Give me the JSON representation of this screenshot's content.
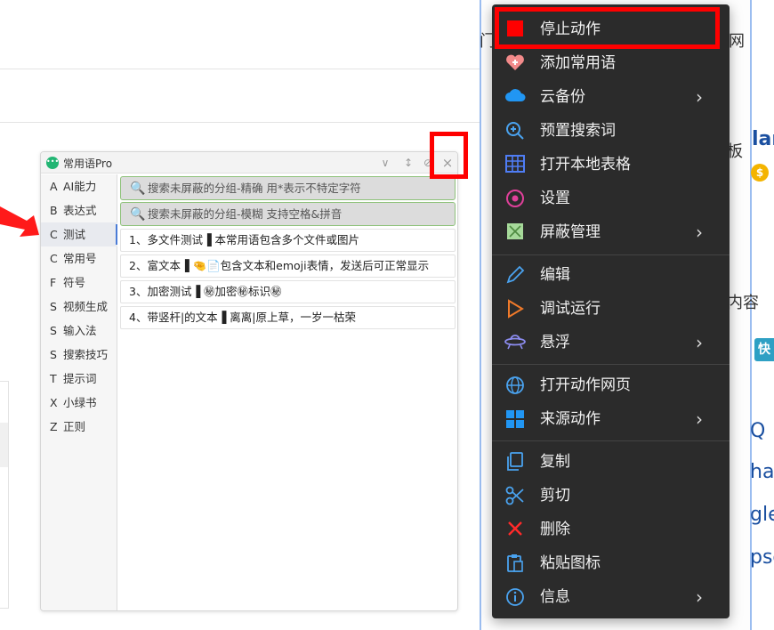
{
  "app": {
    "logo_glyph": "•••",
    "title": "常用语Pro",
    "buttons": {
      "collapse": "∨",
      "sort": "↕",
      "pin": "⊘",
      "close": "×"
    },
    "categories": [
      {
        "key": "A",
        "label": "AI能力"
      },
      {
        "key": "B",
        "label": "表达式"
      },
      {
        "key": "C",
        "label": "测试"
      },
      {
        "key": "C",
        "label": "常用号"
      },
      {
        "key": "F",
        "label": "符号"
      },
      {
        "key": "S",
        "label": "视频生成"
      },
      {
        "key": "S",
        "label": "输入法"
      },
      {
        "key": "S",
        "label": "搜索技巧"
      },
      {
        "key": "T",
        "label": "提示词"
      },
      {
        "key": "X",
        "label": "小绿书"
      },
      {
        "key": "Z",
        "label": "正则"
      }
    ],
    "active_category": 2,
    "search_exact": {
      "icon": "🔍",
      "text": "搜索未屏蔽的分组-精确  用*表示不特定字符"
    },
    "search_fuzzy": {
      "icon": "🔍",
      "text": "搜索未屏蔽的分组-模糊  支持空格&拼音"
    },
    "phrases": [
      "1、多文件测试▐  本常用语包含多个文件或图片",
      "2、富文本▐  🤏📄包含文本和emoji表情，发送后可正常显示",
      "3、加密测试▐  ㊙加密㊙标识㊙",
      "4、带竖杆|的文本▐  离离|原上草，一岁一枯荣"
    ]
  },
  "context_menu": {
    "items": [
      {
        "icon": "stop-icon",
        "label": "停止动作",
        "submenu": false
      },
      {
        "icon": "heart-add-icon",
        "label": "添加常用语",
        "submenu": false
      },
      {
        "icon": "cloud-icon",
        "label": "云备份",
        "submenu": true
      },
      {
        "icon": "search-plus-icon",
        "label": "预置搜索词",
        "submenu": false
      },
      {
        "icon": "table-icon",
        "label": "打开本地表格",
        "submenu": false
      },
      {
        "icon": "gear-icon",
        "label": "设置",
        "submenu": false
      },
      {
        "icon": "block-icon",
        "label": "屏蔽管理",
        "submenu": true
      },
      {
        "icon": "pencil-icon",
        "label": "编辑",
        "submenu": false
      },
      {
        "icon": "play-icon",
        "label": "调试运行",
        "submenu": false
      },
      {
        "icon": "ufo-icon",
        "label": "悬浮",
        "submenu": true
      },
      {
        "icon": "globe-icon",
        "label": "打开动作网页",
        "submenu": false
      },
      {
        "icon": "windows-icon",
        "label": "来源动作",
        "submenu": true
      },
      {
        "icon": "copy-icon",
        "label": "复制",
        "submenu": false
      },
      {
        "icon": "scissors-icon",
        "label": "剪切",
        "submenu": false
      },
      {
        "icon": "delete-icon",
        "label": "删除",
        "submenu": false
      },
      {
        "icon": "paste-icon",
        "label": "粘贴图标",
        "submenu": false
      },
      {
        "icon": "info-icon",
        "label": "信息",
        "submenu": true
      }
    ],
    "submenu_glyph": "›"
  },
  "background": {
    "fragments": [
      "门语",
      "网",
      "板",
      "内容",
      "Q",
      "ha",
      "gle",
      "psc",
      "lar",
      "快"
    ],
    "coin_glyph": "$"
  },
  "colors": {
    "highlight": "#ff0000",
    "menu_bg": "#2b2b2b",
    "search_border": "#8ec27a",
    "accent": "#4a7bd6"
  }
}
